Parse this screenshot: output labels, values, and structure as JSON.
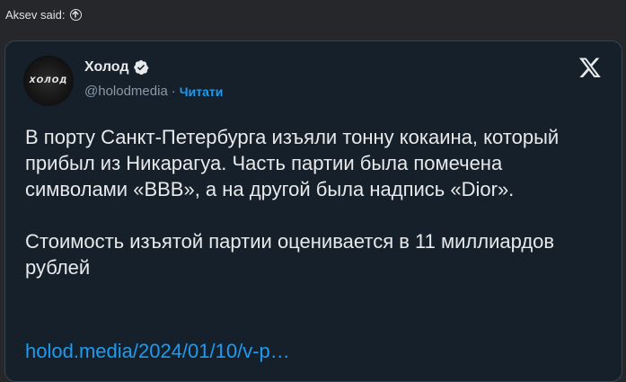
{
  "quote": {
    "author_label": "Aksev said:",
    "jump_icon": "arrow-up-circle-icon"
  },
  "tweet": {
    "avatar_text": "ХОЛОД",
    "display_name": "Холод",
    "verified_icon": "verified-badge-icon",
    "handle": "@holodmedia",
    "separator": "·",
    "follow_label": "Читати",
    "platform_icon": "x-logo-icon",
    "text": "В порту Санкт-Петербурга изъяли тонну кокаина, который прибыл из Никарагуа. Часть партии была помечена символами «BBB», а на другой была надпись «Dior».\n\nСтоимость изъятой партии оценивается в 11 миллиардов рублей",
    "link": "holod.media/2024/01/10/v-p…"
  },
  "colors": {
    "page_background": "#25272a",
    "card_background": "#15202b",
    "card_border": "#38444d",
    "text_primary": "#e7e9ea",
    "text_secondary": "#8b98a5",
    "accent": "#1d9bf0"
  }
}
